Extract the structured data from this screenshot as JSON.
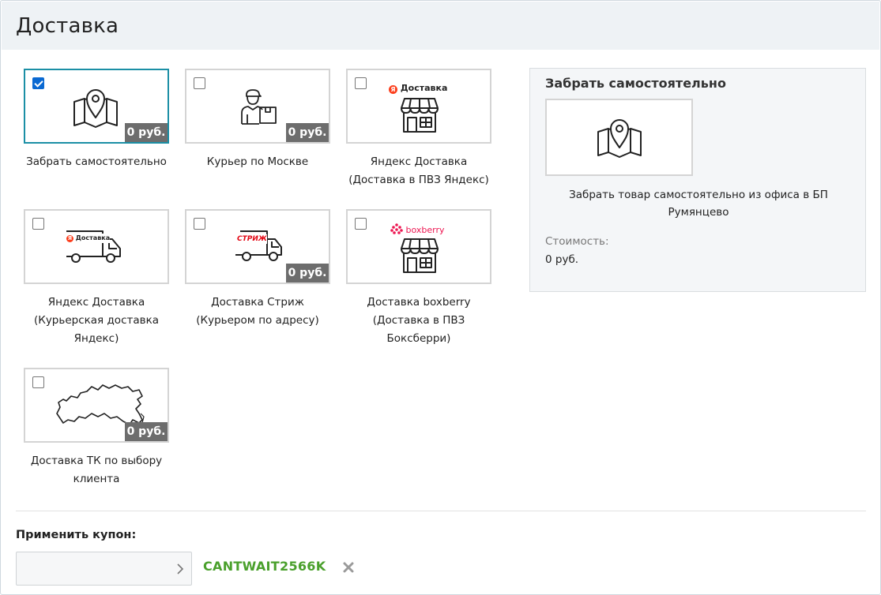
{
  "page_title": "Доставка",
  "delivery_options": [
    {
      "label": "Забрать самостоятельно",
      "price": "0 руб.",
      "checked": true,
      "icon": "map-pin-icon"
    },
    {
      "label": "Курьер по Москве",
      "price": "0 руб.",
      "checked": false,
      "icon": "courier-icon"
    },
    {
      "label": "Яндекс Доставка (Доставка в ПВЗ Яндекс)",
      "price": "",
      "checked": false,
      "icon": "store-icon",
      "brand": "Доставка"
    },
    {
      "label": "Яндекс Доставка (Курьерская доставка Яндекс)",
      "price": "",
      "checked": false,
      "icon": "truck-icon",
      "brand": "Доставка"
    },
    {
      "label": "Доставка Стриж (Курьером по адресу)",
      "price": "0 руб.",
      "checked": false,
      "icon": "truck-icon",
      "brand": "СТРИЖ"
    },
    {
      "label": "Доставка boxberry (Доставка в ПВЗ Боксберри)",
      "price": "",
      "checked": false,
      "icon": "store-icon",
      "brand": "boxberry"
    },
    {
      "label": "Доставка ТК по выбору клиента",
      "price": "0 руб.",
      "checked": false,
      "icon": "russia-map-icon"
    }
  ],
  "details": {
    "title": "Забрать самостоятельно",
    "description": "Забрать товар самостоятельно из офиса в БП Румянцево",
    "cost_label": "Стоимость:",
    "cost_value": "0 руб."
  },
  "coupon": {
    "label": "Применить купон:",
    "input_value": "",
    "applied_code": "CANTWAIT2566K"
  },
  "colors": {
    "selected_border": "#1b8fa5",
    "coupon_code": "#4aa02c",
    "price_badge": "#6d6d6d",
    "yandex_red": "#fc3f1d",
    "boxberry_red": "#ed1651",
    "strizh_red": "#e30613"
  }
}
